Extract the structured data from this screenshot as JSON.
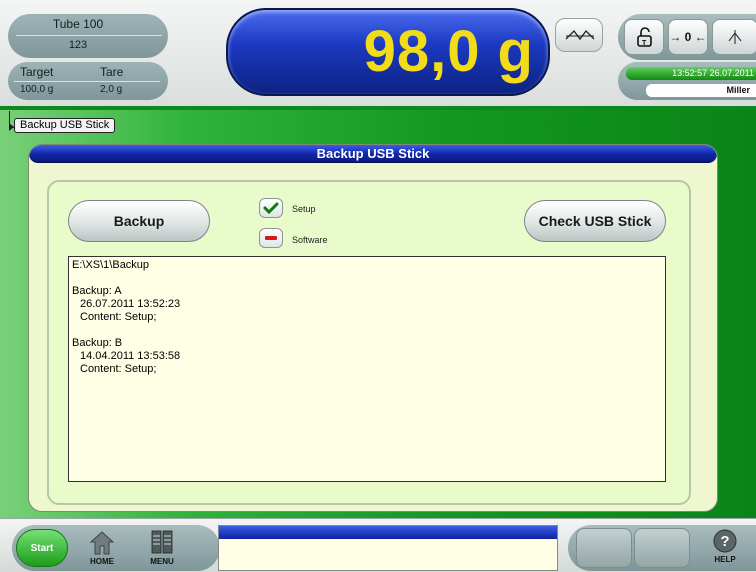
{
  "header": {
    "product_name": "Tube 100",
    "product_id": "123",
    "target_label": "Target",
    "target_value": "100,0 g",
    "tare_label": "Tare",
    "tare_value": "2,0 g",
    "weight_value": "98,0 g",
    "zero_label": "→ 0 ←",
    "time_date": "13:52:57  26.07.2011",
    "user": "Miller"
  },
  "breadcrumb": {
    "label": "Backup USB Stick"
  },
  "panel": {
    "title": "Backup USB Stick",
    "backup_button": "Backup",
    "check_button": "Check USB Stick",
    "options": [
      {
        "label": "Setup",
        "state": "checked"
      },
      {
        "label": "Software",
        "state": "unchecked"
      }
    ],
    "log": {
      "path": "E:\\XS\\1\\Backup",
      "entries": [
        {
          "name": "Backup: A",
          "datetime": "26.07.2011  13:52:23",
          "content": "Content: Setup;"
        },
        {
          "name": "Backup: B",
          "datetime": "14.04.2011  13:53:58",
          "content": "Content: Setup;"
        }
      ]
    }
  },
  "footer": {
    "start_label": "Start",
    "home_label": "HOME",
    "menu_label": "MENU",
    "help_label": "HELP"
  },
  "colors": {
    "accent_blue": "#1c3ac2",
    "weight_yellow": "#f2dc1a",
    "status_green": "#138a13",
    "panel_bg": "#eef7d0"
  }
}
